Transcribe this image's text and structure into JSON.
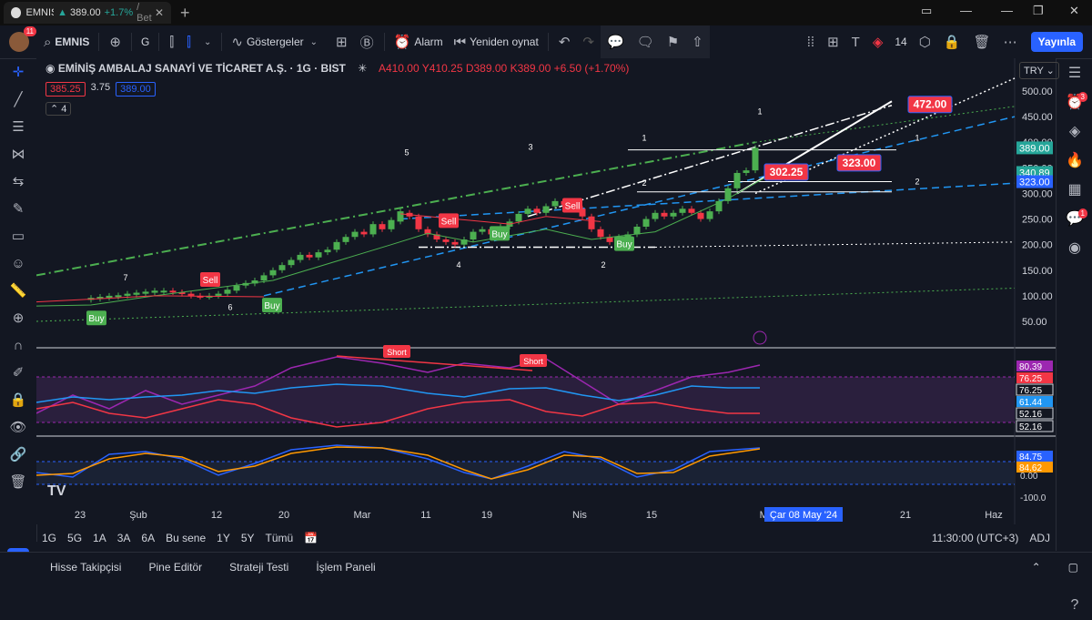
{
  "browser": {
    "tab_title": "EMNIS",
    "tab_price": "389.00",
    "tab_change": "+1.7%",
    "tab_suffix": "/ Bet",
    "new_tab": "+"
  },
  "toolbar": {
    "symbol": "EMNIS",
    "avatar_badge": "11",
    "interval": "G",
    "indicators_label": "Göstergeler",
    "alarm_label": "Alarm",
    "replay_label": "Yeniden oynat",
    "font_size": "14",
    "publish_label": "Yayınla"
  },
  "legend": {
    "title": "EMİNİŞ AMBALAJ SANAYİ VE TİCARET A.Ş. · 1G · BIST",
    "open": "A410.00",
    "high": "Y410.25",
    "low": "D389.00",
    "close": "K389.00",
    "change": "+6.50 (+1.70%)",
    "bid": "385.25",
    "spread": "3.75",
    "ask": "389.00",
    "indicator_count": "4",
    "currency": "TRY"
  },
  "chart_data": {
    "type": "candlestick",
    "price_axis": [
      "500.00",
      "450.00",
      "400.00",
      "350.00",
      "300.00",
      "250.00",
      "200.00",
      "150.00",
      "100.00",
      "50.00"
    ],
    "price_tags": [
      {
        "label": "389.00",
        "color": "#26a69a"
      },
      {
        "label": "340.89",
        "color": "#26a69a"
      },
      {
        "label": "323.00",
        "color": "#2962ff"
      }
    ],
    "time_axis": [
      "23",
      "Şub",
      "12",
      "20",
      "Mar",
      "11",
      "19",
      "Nis",
      "15",
      "May",
      "21",
      "Haz"
    ],
    "crosshair_date": "Çar 08 May '24",
    "annotations": [
      {
        "text": "472.00",
        "kind": "target"
      },
      {
        "text": "302.25",
        "kind": "level"
      },
      {
        "text": "323.00",
        "kind": "level"
      }
    ],
    "signals": [
      "Buy",
      "Sell",
      "Buy",
      "Sell",
      "Buy",
      "Sell",
      "Buy"
    ],
    "wave_labels": [
      "7",
      "6",
      "5",
      "4",
      "3",
      "2",
      "1",
      "1",
      "1",
      "2",
      "2"
    ],
    "rsi_panel": {
      "tags": [
        {
          "label": "80.39",
          "color": "#9c27b0"
        },
        {
          "label": "76.25",
          "color": "#f23645"
        },
        {
          "label": "76.25",
          "color": "#d1d4dc"
        },
        {
          "label": "61.44",
          "color": "#2196f3"
        },
        {
          "label": "52.16",
          "color": "#d1d4dc"
        },
        {
          "label": "52.16",
          "color": "#d1d4dc"
        }
      ],
      "labels": [
        "Short",
        "Short"
      ]
    },
    "osc_panel": {
      "tags": [
        {
          "label": "84.75",
          "color": "#2962ff"
        },
        {
          "label": "84.62",
          "color": "#ff9800"
        }
      ],
      "axis": [
        "0.00",
        "-100.0"
      ]
    }
  },
  "bottom": {
    "ranges": [
      "1G",
      "5G",
      "1A",
      "3A",
      "6A",
      "Bu sene",
      "1Y",
      "5Y",
      "Tümü"
    ],
    "time": "11:30:00 (UTC+3)",
    "adj": "ADJ"
  },
  "footer": {
    "tabs": [
      "Hisse Takipçisi",
      "Pine Editör",
      "Strateji Testi",
      "İşlem Paneli"
    ]
  },
  "sidebar_badges": {
    "alerts": "3",
    "chat": "1"
  }
}
